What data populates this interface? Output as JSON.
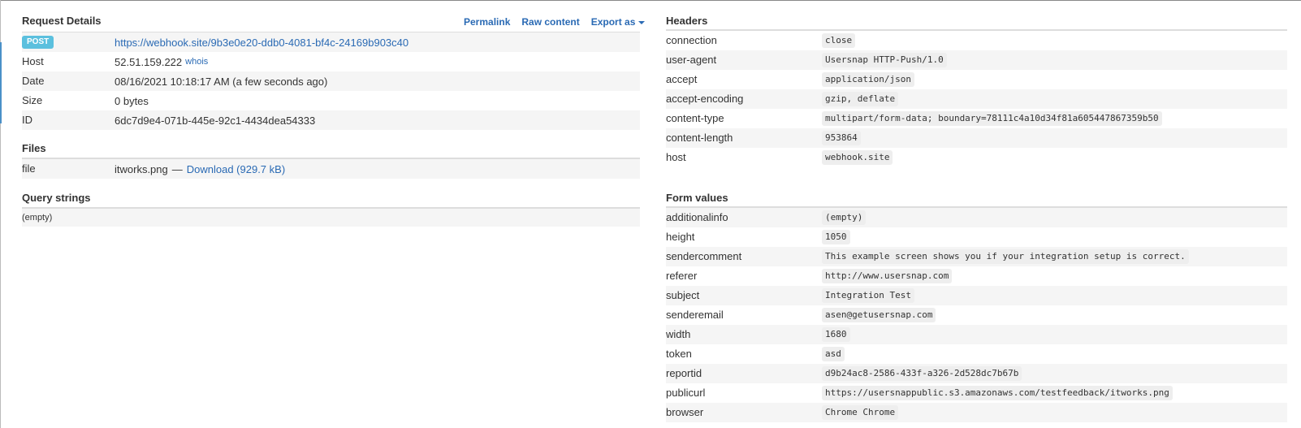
{
  "request": {
    "title": "Request Details",
    "toolbar": {
      "permalink": "Permalink",
      "raw": "Raw content",
      "export": "Export as"
    },
    "method": "POST",
    "url": "https://webhook.site/9b3e0e20-ddb0-4081-bf4c-24169b903c40",
    "rows": [
      {
        "key": "Host",
        "value": "52.51.159.222",
        "extra": "whois"
      },
      {
        "key": "Date",
        "value": "08/16/2021 10:18:17 AM (a few seconds ago)"
      },
      {
        "key": "Size",
        "value": "0 bytes"
      },
      {
        "key": "ID",
        "value": "6dc7d9e4-071b-445e-92c1-4434dea54333"
      }
    ]
  },
  "files": {
    "title": "Files",
    "key": "file",
    "name": "itworks.png",
    "sep": "—",
    "download": "Download (929.7 kB)"
  },
  "query": {
    "title": "Query strings",
    "empty": "(empty)"
  },
  "headers": {
    "title": "Headers",
    "rows": [
      {
        "key": "connection",
        "value": "close"
      },
      {
        "key": "user-agent",
        "value": "Usersnap HTTP-Push/1.0"
      },
      {
        "key": "accept",
        "value": "application/json"
      },
      {
        "key": "accept-encoding",
        "value": "gzip, deflate"
      },
      {
        "key": "content-type",
        "value": "multipart/form-data; boundary=78111c4a10d34f81a605447867359b50"
      },
      {
        "key": "content-length",
        "value": "953864"
      },
      {
        "key": "host",
        "value": "webhook.site"
      }
    ]
  },
  "form": {
    "title": "Form values",
    "rows": [
      {
        "key": "additionalinfo",
        "value": "(empty)"
      },
      {
        "key": "height",
        "value": "1050"
      },
      {
        "key": "sendercomment",
        "value": "This example screen shows you if your integration setup is correct."
      },
      {
        "key": "referer",
        "value": "http://www.usersnap.com"
      },
      {
        "key": "subject",
        "value": "Integration Test"
      },
      {
        "key": "senderemail",
        "value": "asen@getusersnap.com"
      },
      {
        "key": "width",
        "value": "1680"
      },
      {
        "key": "token",
        "value": "asd"
      },
      {
        "key": "reportid",
        "value": "d9b24ac8-2586-433f-a326-2d528dc7b67b"
      },
      {
        "key": "publicurl",
        "value": "https://usersnappublic.s3.amazonaws.com/testfeedback/itworks.png"
      },
      {
        "key": "browser",
        "value": "Chrome Chrome"
      }
    ]
  }
}
